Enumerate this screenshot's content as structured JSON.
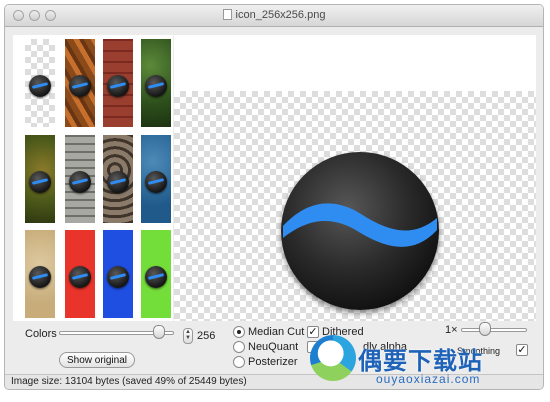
{
  "window": {
    "title": "icon_256x256.png"
  },
  "thumbnails": [
    {
      "name": "thumb-transparent"
    },
    {
      "name": "thumb-rust"
    },
    {
      "name": "thumb-brick"
    },
    {
      "name": "thumb-leaves"
    },
    {
      "name": "thumb-moss"
    },
    {
      "name": "thumb-wood"
    },
    {
      "name": "thumb-stone"
    },
    {
      "name": "thumb-water"
    },
    {
      "name": "thumb-sand"
    },
    {
      "name": "thumb-red"
    },
    {
      "name": "thumb-blue"
    },
    {
      "name": "thumb-green"
    }
  ],
  "controls": {
    "colors_label": "Colors",
    "colors_value": "256",
    "show_original_label": "Show original",
    "median_cut_label": "Median Cut",
    "neuquant_label": "NeuQuant",
    "posterizer_label": "Posterizer",
    "selected_algorithm": "Median Cut",
    "dithered_label": "Dithered",
    "dithered_checked": true,
    "ie_friendly_label": "IE-friendly alpha",
    "ie_friendly_visible_label": "I",
    "ie_friendly_tail_label": "dly alpha",
    "zoom_label": "1×",
    "smoothing_label": "Smoothing",
    "smoothing_visible_label": "Smoothing",
    "smoothing_tail_label": "ng"
  },
  "status": {
    "text": "Image size: 13104 bytes (saved 49% of 25449 bytes)"
  },
  "watermark": {
    "text": "偶要下载站",
    "url": "ouyaoxiazai.com"
  },
  "colors": {
    "accent_blue": "#2f8df2"
  }
}
